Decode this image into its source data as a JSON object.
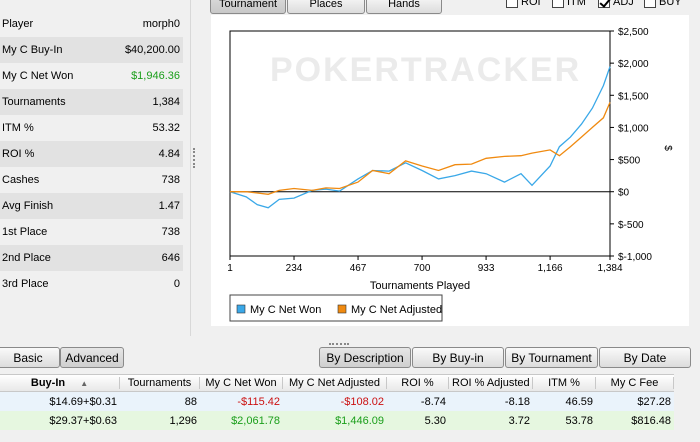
{
  "top_tabs": [
    "Tournament",
    "Places",
    "Hands"
  ],
  "checkboxes": [
    {
      "label": "ROI",
      "checked": false
    },
    {
      "label": "ITM",
      "checked": false
    },
    {
      "label": "ADJ",
      "checked": true
    },
    {
      "label": "BUY",
      "checked": false
    }
  ],
  "stats": [
    {
      "label": "Player",
      "value": "morph0"
    },
    {
      "label": "My C Buy-In",
      "value": "$40,200.00"
    },
    {
      "label": "My C Net Won",
      "value": "$1,946.36"
    },
    {
      "label": "Tournaments",
      "value": "1,384"
    },
    {
      "label": "ITM %",
      "value": "53.32"
    },
    {
      "label": "ROI %",
      "value": "4.84"
    },
    {
      "label": "Cashes",
      "value": "738"
    },
    {
      "label": "Avg Finish",
      "value": "1.47"
    },
    {
      "label": "1st Place",
      "value": "738"
    },
    {
      "label": "2nd Place",
      "value": "646"
    },
    {
      "label": "3rd Place",
      "value": "0"
    }
  ],
  "chart": {
    "watermark": "POKERTRACKER",
    "xlabel": "Tournaments Played",
    "ylabel": "$",
    "x_ticks": [
      "1",
      "234",
      "467",
      "700",
      "933",
      "1,166",
      "1,384"
    ],
    "y_ticks": [
      "$2,500",
      "$2,000",
      "$1,500",
      "$1,000",
      "$500",
      "$0",
      "$-500",
      "$-1,000"
    ],
    "legend": [
      "My C Net Won",
      "My C Net Adjusted"
    ],
    "colors": {
      "net_won": "#3aa8e8",
      "net_adjusted": "#f08a10"
    }
  },
  "chart_data": {
    "type": "line",
    "xlabel": "Tournaments Played",
    "ylabel": "$",
    "xlim": [
      1,
      1384
    ],
    "ylim": [
      -1000,
      2500
    ],
    "series": [
      {
        "name": "My C Net Won",
        "x": [
          1,
          60,
          100,
          140,
          180,
          234,
          300,
          350,
          400,
          467,
          520,
          580,
          640,
          700,
          760,
          820,
          880,
          933,
          1000,
          1060,
          1100,
          1166,
          1200,
          1240,
          1280,
          1320,
          1360,
          1384
        ],
        "y": [
          0,
          -80,
          -200,
          -250,
          -120,
          -100,
          20,
          40,
          10,
          200,
          330,
          320,
          450,
          330,
          200,
          250,
          320,
          280,
          150,
          280,
          100,
          400,
          700,
          850,
          1050,
          1300,
          1650,
          1946
        ]
      },
      {
        "name": "My C Net Adjusted",
        "x": [
          1,
          60,
          100,
          140,
          180,
          234,
          300,
          350,
          400,
          467,
          520,
          580,
          640,
          700,
          760,
          820,
          880,
          933,
          1000,
          1060,
          1100,
          1166,
          1200,
          1240,
          1280,
          1320,
          1360,
          1384
        ],
        "y": [
          0,
          0,
          -20,
          -40,
          20,
          50,
          20,
          60,
          50,
          150,
          330,
          280,
          480,
          400,
          330,
          420,
          430,
          520,
          550,
          560,
          600,
          650,
          560,
          700,
          850,
          1000,
          1150,
          1390
        ]
      }
    ]
  },
  "bottom_tabs": [
    "Basic",
    "Advanced"
  ],
  "sort_buttons": [
    "By Description",
    "By Buy-in",
    "By Tournament",
    "By Date"
  ],
  "table": {
    "headers": [
      "Buy-In",
      "Tournaments",
      "My C Net Won",
      "My C Net Adjusted",
      "ROI %",
      "ROI % Adjusted",
      "ITM %",
      "My C Fee"
    ],
    "rows": [
      [
        "$14.69+$0.31",
        "88",
        "-$115.42",
        "-$108.02",
        "-8.74",
        "-8.18",
        "46.59",
        "$27.28"
      ],
      [
        "$29.37+$0.63",
        "1,296",
        "$2,061.78",
        "$1,446.09",
        "5.30",
        "3.72",
        "53.78",
        "$816.48"
      ]
    ]
  }
}
